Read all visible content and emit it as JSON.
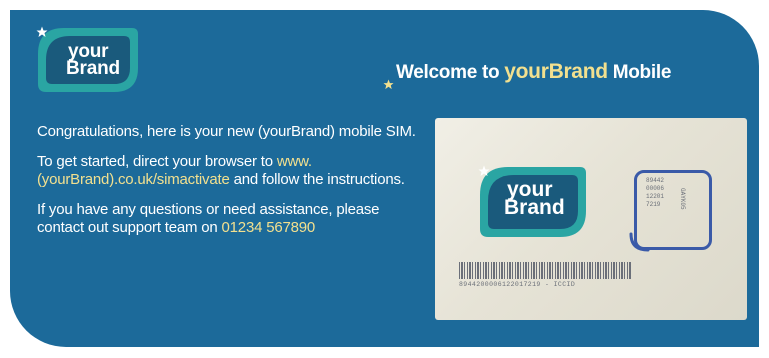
{
  "logo": {
    "line1": "your",
    "line2": "Brand",
    "star": "★"
  },
  "headline": {
    "prefix": "Welcome to ",
    "brand": "yourBrand",
    "suffix": " Mobile",
    "star": "★"
  },
  "paragraphs": {
    "p1": "Congratulations,  here is your new (yourBrand) mobile SIM.",
    "p2_before": "To get started, direct your browser to ",
    "p2_link": "www.(yourBrand).co.uk/simactivate",
    "p2_after": " and follow the instructions.",
    "p3_before": "If you have any questions or need assistance, please contact out support team on ",
    "p3_phone": "01234 567890"
  },
  "sim": {
    "logo_line1": "your",
    "logo_line2": "Brand",
    "chip_lines": [
      "89442",
      "00006",
      "12201",
      "7219"
    ],
    "chip_side": "GAYK05",
    "iccid": "8944200006122017219 - ICCID"
  },
  "colors": {
    "card_bg": "#1c6a9a",
    "accent": "#f2e08f",
    "logo_teal": "#2aa5a3",
    "logo_dark": "#1a5a7c",
    "chip": "#3a5aa8"
  }
}
